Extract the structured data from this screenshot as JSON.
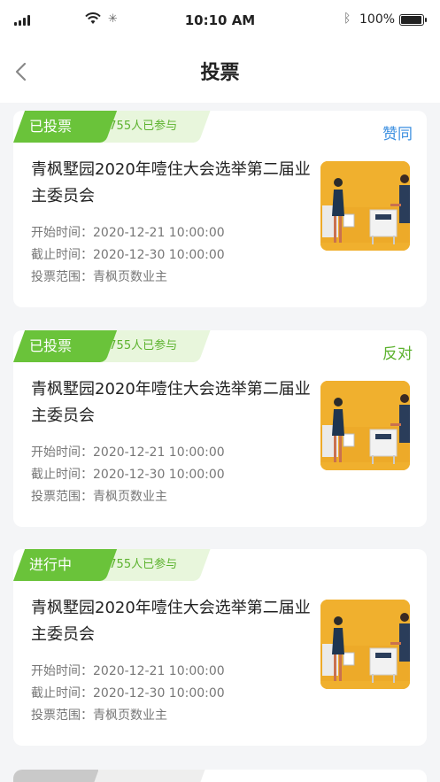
{
  "status_bar": {
    "time": "10:10 AM",
    "battery": "100%",
    "battery_level": 1.0
  },
  "nav": {
    "title": "投票"
  },
  "colors": {
    "green": "#6ac33a",
    "green_light": "#e8f6dc",
    "agree_blue": "#3b8fe0",
    "oppose_green": "#5cb22e"
  },
  "cards": [
    {
      "status": "已投票",
      "participants": "1755人已参与",
      "result": "赞同",
      "result_color": "#3b8fe0",
      "title": "青枫墅园2020年噎住大会选举第二届业主委员会",
      "start": "开始时间：2020-12-21 10:00:00",
      "end": "截止时间：2020-12-30 10:00:00",
      "scope": "投票范围：青枫页数业主",
      "image": "voting-illustration"
    },
    {
      "status": "已投票",
      "participants": "1755人已参与",
      "result": "反对",
      "result_color": "#5cb22e",
      "title": "青枫墅园2020年噎住大会选举第二届业主委员会",
      "start": "开始时间：2020-12-21 10:00:00",
      "end": "截止时间：2020-12-30 10:00:00",
      "scope": "投票范围：青枫页数业主",
      "image": "voting-illustration"
    },
    {
      "status": "进行中",
      "participants": "1755人已参与",
      "result": "",
      "result_color": "#5cb22e",
      "title": "青枫墅园2020年噎住大会选举第二届业主委员会",
      "start": "开始时间：2020-12-21 10:00:00",
      "end": "截止时间：2020-12-30 10:00:00",
      "scope": "投票范围：青枫页数业主",
      "image": "voting-illustration"
    }
  ]
}
